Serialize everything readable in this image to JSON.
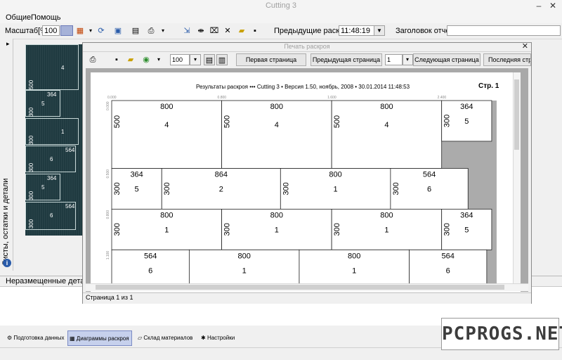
{
  "window": {
    "title": "Cutting 3",
    "minimize": "–",
    "close": "✕"
  },
  "menu": [
    "Общие",
    "Помощь"
  ],
  "toolbar": {
    "scale_label": "Масштаб[%]",
    "scale_value": "100",
    "prev_cuts_label": "Предыдущие раскрои",
    "prev_cuts_value": "11:48:19",
    "report_header_label": "Заголовок отчета",
    "report_header_value": ""
  },
  "left_panel": {
    "vertical_label": "Листы, остатки и детали",
    "info": "i",
    "arrow": "▸"
  },
  "thumbnails": [
    {
      "w": "",
      "n": "4",
      "side": "500"
    },
    {
      "w": "364",
      "n": "5",
      "side": "300"
    },
    {
      "w": "",
      "n": "1",
      "side": "300"
    },
    {
      "w": "564",
      "n": "6",
      "side": "300"
    },
    {
      "w": "364",
      "n": "5",
      "side": "300"
    },
    {
      "w": "564",
      "n": "6",
      "side": "300"
    }
  ],
  "preview": {
    "title": "Печать раскроя",
    "zoom": "100",
    "btn_first": "Первая страница",
    "btn_prev": "Предыдущая страница",
    "page_num": "1",
    "btn_next": "Следующая страница",
    "btn_last": "Последняя стра",
    "status": "Страница 1 из 1"
  },
  "report": {
    "header": "Результаты раскроя ••• Cutting 3 • Версия 1.50, ноябрь, 2008 • 30.01.2014 11:48:53",
    "page_label": "Стр.  1",
    "ruler_x": [
      "0.000",
      "0.800",
      "1.600",
      "2.400"
    ],
    "ruler_y": [
      "0.000",
      "0.500",
      "0.800",
      "1.100"
    ],
    "rows": [
      [
        {
          "w": "800",
          "h": "500",
          "n": "4"
        },
        {
          "w": "800",
          "h": "500",
          "n": "4"
        },
        {
          "w": "800",
          "h": "500",
          "n": "4"
        },
        {
          "w": "364",
          "h": "300",
          "n": "5"
        }
      ],
      [
        {
          "w": "364",
          "h": "300",
          "n": "5"
        },
        {
          "w": "864",
          "h": "300",
          "n": "2"
        },
        {
          "w": "800",
          "h": "300",
          "n": "1"
        },
        {
          "w": "564",
          "h": "300",
          "n": "6"
        }
      ],
      [
        {
          "w": "800",
          "h": "300",
          "n": "1"
        },
        {
          "w": "800",
          "h": "300",
          "n": "1"
        },
        {
          "w": "800",
          "h": "300",
          "n": "1"
        },
        {
          "w": "364",
          "h": "300",
          "n": "5"
        }
      ],
      [
        {
          "w": "564",
          "h": "",
          "n": "6"
        },
        {
          "w": "800",
          "h": "",
          "n": "1"
        },
        {
          "w": "800",
          "h": "",
          "n": "1"
        },
        {
          "w": "564",
          "h": "",
          "n": "6"
        }
      ]
    ]
  },
  "bottom_panel": {
    "title": "Неразмещенные детали"
  },
  "tabs": [
    {
      "label": "Подготовка данных",
      "active": false
    },
    {
      "label": "Диаграммы раскроя",
      "active": true
    },
    {
      "label": "Склад материалов",
      "active": false
    },
    {
      "label": "Настройки",
      "active": false
    }
  ],
  "watermark": "PCPROGS.NET"
}
